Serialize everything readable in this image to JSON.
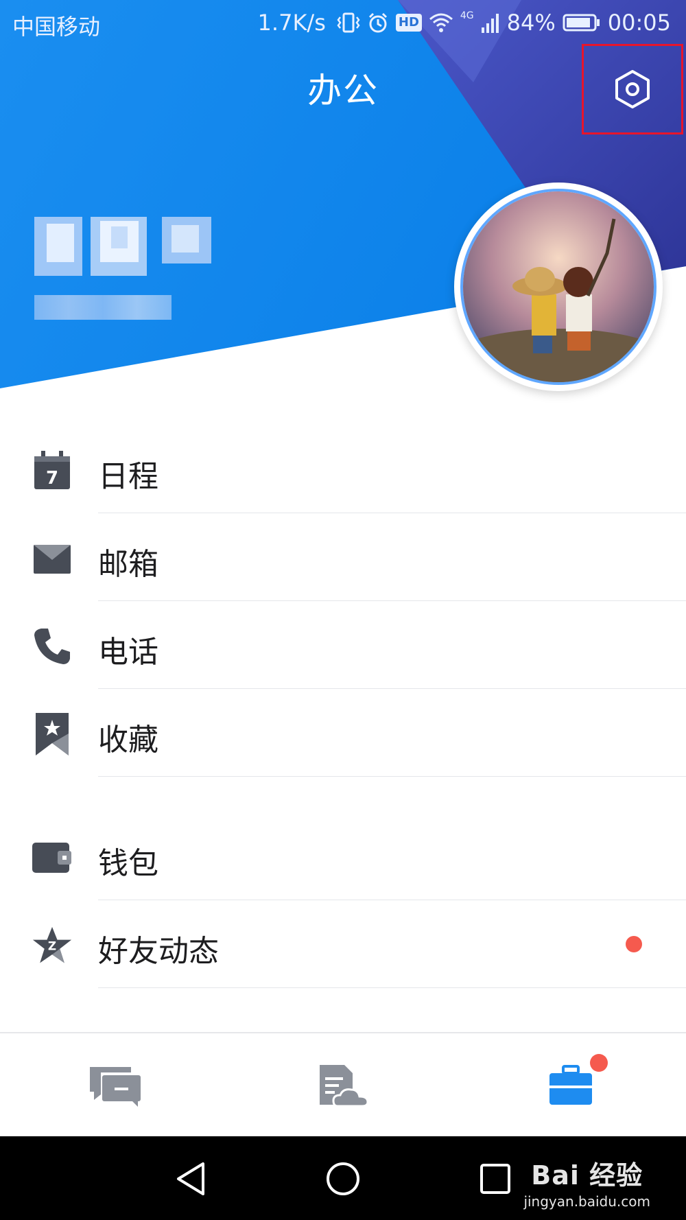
{
  "status_bar": {
    "carrier": "中国移动",
    "net_speed": "1.7K/s",
    "hd_badge": "HD",
    "network_type": "4G",
    "battery": "84%",
    "time": "00:05",
    "icons": [
      "vibrate-icon",
      "alarm-icon",
      "hd-icon",
      "wifi-icon",
      "signal-icon",
      "battery-icon"
    ]
  },
  "header": {
    "title": "办公",
    "settings_icon": "settings-hexagon-icon",
    "colors": {
      "primary": "#0a84ed",
      "accent_dark": "#3a3fa8",
      "highlight_box": "#e8152b"
    }
  },
  "menu": {
    "group1": [
      {
        "label": "日程",
        "icon": "calendar-icon",
        "badge": false
      },
      {
        "label": "邮箱",
        "icon": "mail-icon",
        "badge": false
      },
      {
        "label": "电话",
        "icon": "phone-icon",
        "badge": false
      },
      {
        "label": "收藏",
        "icon": "bookmark-star-icon",
        "badge": false
      }
    ],
    "group2": [
      {
        "label": "钱包",
        "icon": "wallet-icon",
        "badge": false
      },
      {
        "label": "好友动态",
        "icon": "qzone-star-icon",
        "badge": true
      }
    ]
  },
  "tab_bar": {
    "tabs": [
      {
        "icon": "messages-icon",
        "active": false,
        "badge": false
      },
      {
        "icon": "cloud-doc-icon",
        "active": false,
        "badge": true
      },
      {
        "icon": "briefcase-icon",
        "active": true,
        "badge": true
      }
    ],
    "colors": {
      "active": "#1e8cf0",
      "inactive": "#8b8f97",
      "badge": "#f55a4e"
    }
  },
  "nav_bar": {
    "buttons": [
      "back-icon",
      "home-icon",
      "recents-icon"
    ]
  },
  "watermark": {
    "logo": "Bai 经验",
    "url": "jingyan.baidu.com"
  }
}
